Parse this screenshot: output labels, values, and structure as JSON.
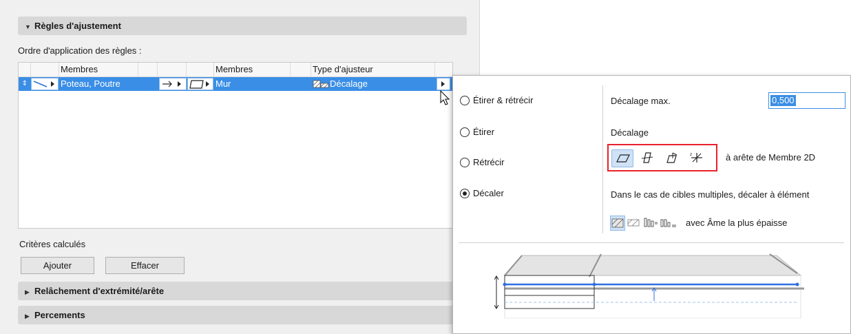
{
  "sections": {
    "adjust_rules": "Règles d'ajustement",
    "extremity_release": "Relâchement d'extrémité/arête",
    "openings": "Percements"
  },
  "rules": {
    "order_label": "Ordre d'application des règles :",
    "columns": [
      "Membres",
      "Membres",
      "Type d'ajusteur"
    ],
    "row": {
      "members_from": "Poteau, Poutre",
      "members_to": "Mur",
      "adjuster_type": "Décalage"
    }
  },
  "computed_criteria": "Critères calculés",
  "buttons": {
    "add": "Ajouter",
    "delete": "Effacer"
  },
  "popup": {
    "options": [
      "Étirer & rétrécir",
      "Étirer",
      "Rétrécir",
      "Décaler"
    ],
    "selected_option": "Décaler",
    "max_offset_label": "Décalage max.",
    "max_offset_value": "0,500",
    "offset_label": "Décalage",
    "offset_suffix": "à arête de Membre 2D",
    "multi_target_label": "Dans le cas de cibles multiples, décaler à élément",
    "multi_target_suffix": "avec Âme la plus épaisse",
    "offset_icons": [
      "parallelogram-icon",
      "vertical-plane-icon",
      "angled-plane-icon",
      "axis-move-icon"
    ]
  },
  "colors": {
    "accent": "#3a8ee6",
    "highlight_box": "#e8212b",
    "preview_line": "#2f6fe0"
  }
}
